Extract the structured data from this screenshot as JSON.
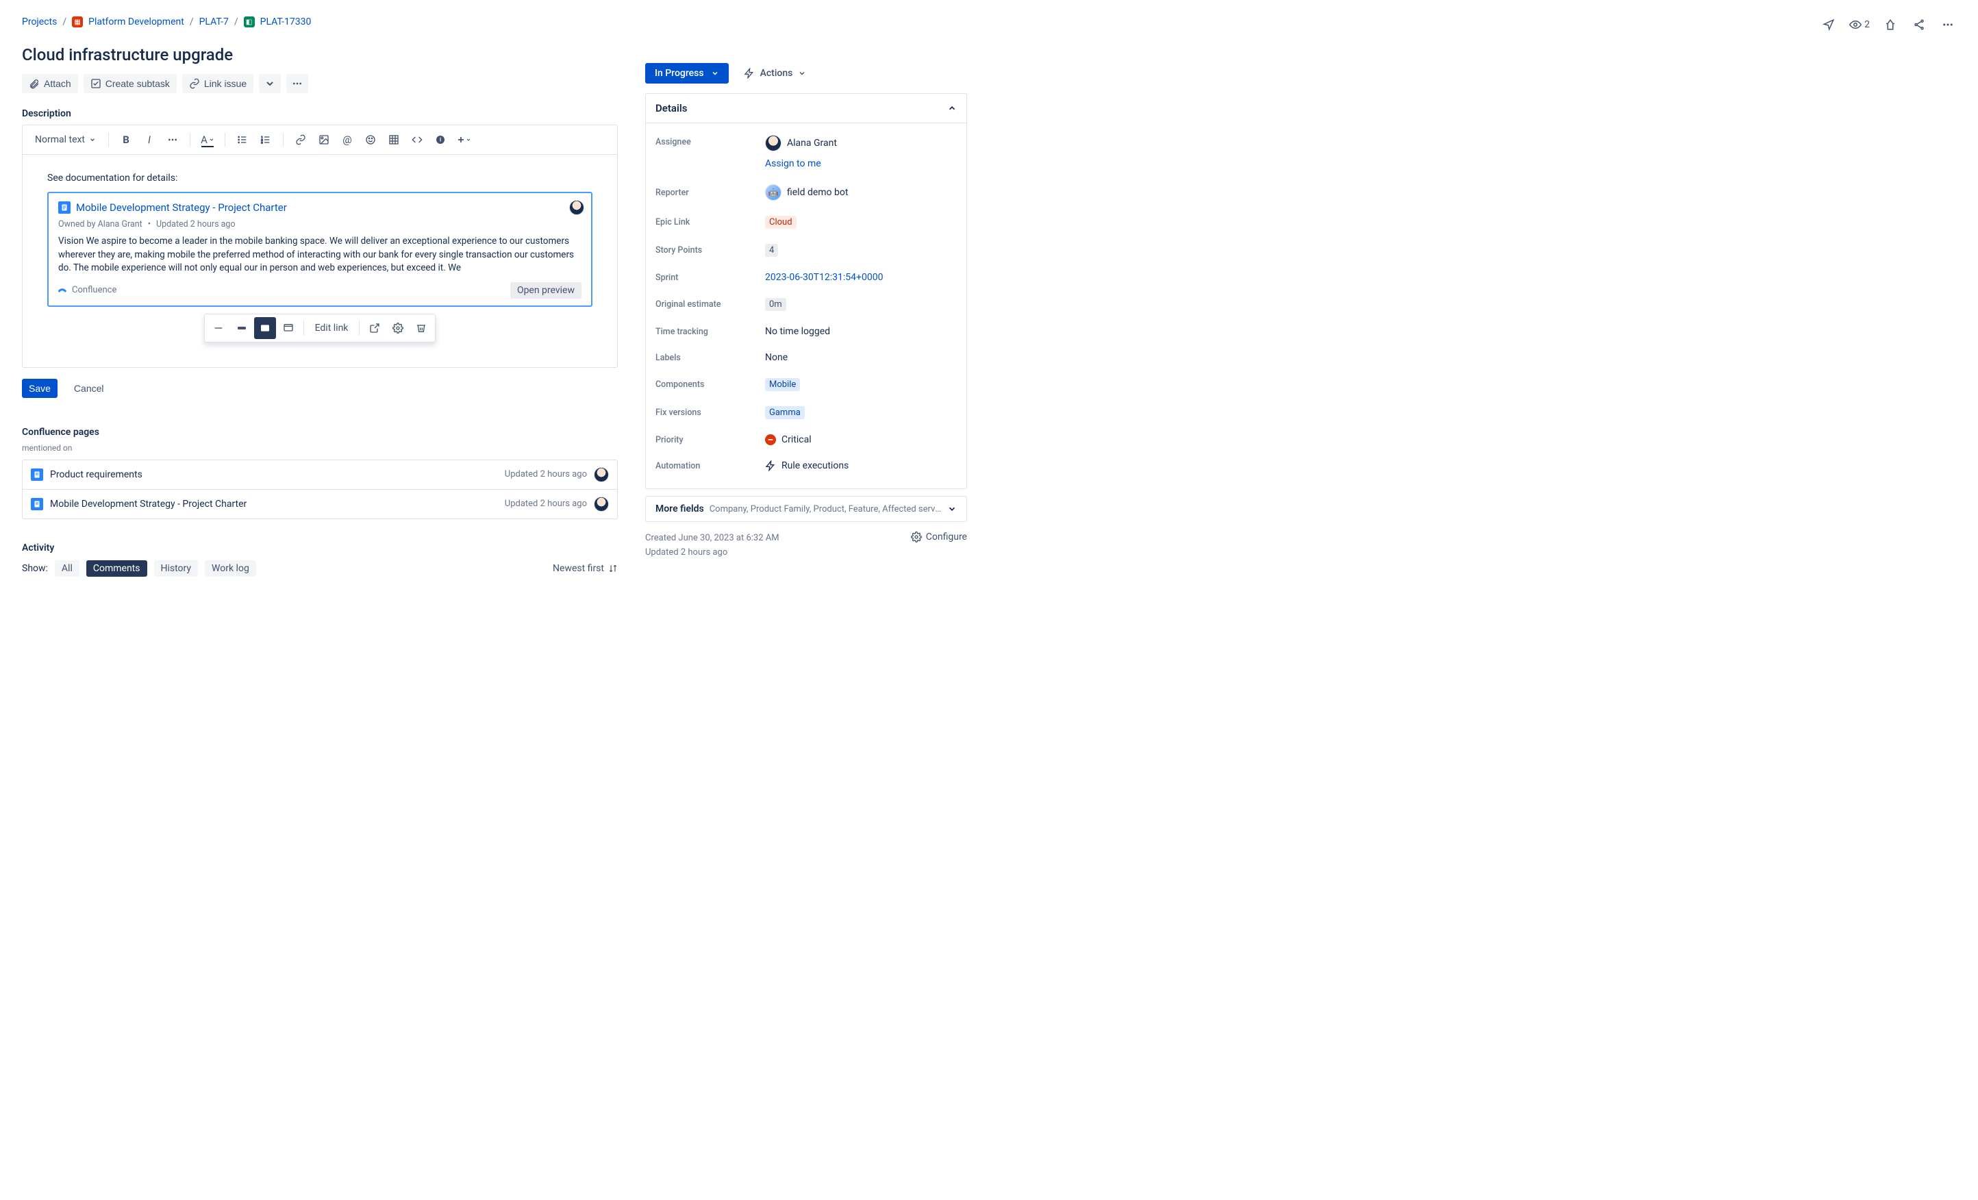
{
  "breadcrumb": {
    "projects": "Projects",
    "project_name": "Platform Development",
    "epic_key": "PLAT-7",
    "issue_key": "PLAT-17330"
  },
  "watchers_count": "2",
  "issue_title": "Cloud infrastructure upgrade",
  "toolbar": {
    "attach": "Attach",
    "create_subtask": "Create subtask",
    "link_issue": "Link issue"
  },
  "description": {
    "label": "Description",
    "text_style": "Normal text",
    "body_intro": "See documentation for details:",
    "smart_card": {
      "title": "Mobile Development Strategy - Project Charter",
      "owned_by": "Owned by Alana Grant",
      "updated": "Updated 2 hours ago",
      "preview": "Vision We aspire to become a leader in the mobile banking space. We will deliver an exceptional experience to our customers wherever they are, making mobile the preferred method of interacting with our bank for every single transaction our customers do. The mobile experience will not only equal our in person and web experiences, but exceed it. We",
      "source": "Confluence",
      "open_preview": "Open preview"
    },
    "floating_toolbar": {
      "edit_link": "Edit link"
    },
    "save": "Save",
    "cancel": "Cancel"
  },
  "confluence": {
    "heading": "Confluence pages",
    "sub": "mentioned on",
    "items": [
      {
        "title": "Product requirements",
        "updated": "Updated 2 hours ago"
      },
      {
        "title": "Mobile Development Strategy - Project Charter",
        "updated": "Updated 2 hours ago"
      }
    ]
  },
  "activity": {
    "heading": "Activity",
    "show": "Show:",
    "tabs": {
      "all": "All",
      "comments": "Comments",
      "history": "History",
      "worklog": "Work log"
    },
    "sort": "Newest first"
  },
  "status": {
    "label": "In Progress",
    "actions": "Actions"
  },
  "details": {
    "header": "Details",
    "assignee_label": "Assignee",
    "assignee_value": "Alana Grant",
    "assign_to_me": "Assign to me",
    "reporter_label": "Reporter",
    "reporter_value": "field demo bot",
    "epic_link_label": "Epic Link",
    "epic_link_value": "Cloud",
    "story_points_label": "Story Points",
    "story_points_value": "4",
    "sprint_label": "Sprint",
    "sprint_value": "2023-06-30T12:31:54+0000",
    "orig_est_label": "Original estimate",
    "orig_est_value": "0m",
    "time_tracking_label": "Time tracking",
    "time_tracking_value": "No time logged",
    "labels_label": "Labels",
    "labels_value": "None",
    "components_label": "Components",
    "components_value": "Mobile",
    "fix_label": "Fix versions",
    "fix_value": "Gamma",
    "priority_label": "Priority",
    "priority_value": "Critical",
    "automation_label": "Automation",
    "automation_value": "Rule executions"
  },
  "more_fields": {
    "label": "More fields",
    "sub": "Company, Product Family, Product, Feature, Affected service..."
  },
  "meta": {
    "created": "Created June 30, 2023 at 6:32 AM",
    "updated": "Updated 2 hours ago",
    "configure": "Configure"
  }
}
